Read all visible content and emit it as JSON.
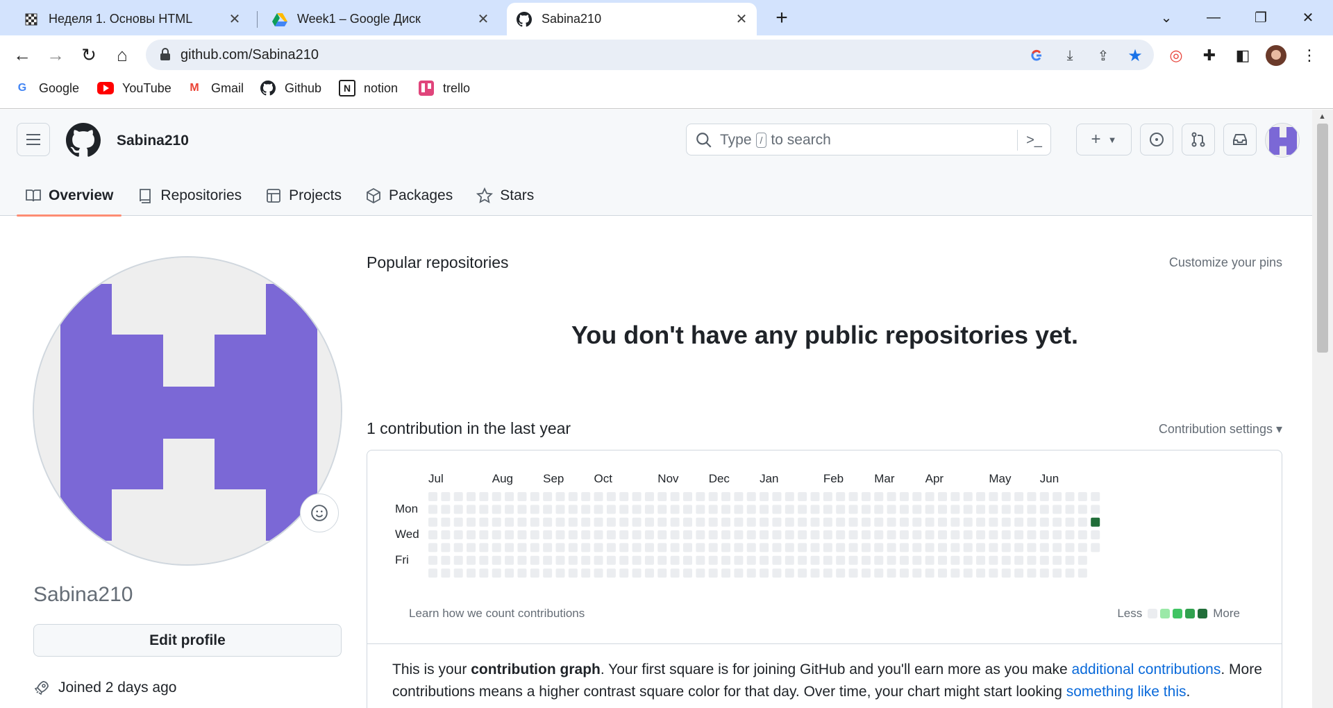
{
  "browser": {
    "tabs": [
      {
        "title": "Неделя 1. Основы HTML",
        "icon": "checkered-flag-icon"
      },
      {
        "title": "Week1 – Google Диск",
        "icon": "google-drive-icon"
      },
      {
        "title": "Sabina210",
        "icon": "github-icon"
      }
    ],
    "url": "github.com/Sabina210",
    "bookmarks": [
      "Google",
      "YouTube",
      "Gmail",
      "Github",
      "notion",
      "trello"
    ]
  },
  "github": {
    "username": "Sabina210",
    "search_placeholder_before": "Type",
    "search_key": "/",
    "search_placeholder_after": "to search",
    "tabs": [
      "Overview",
      "Repositories",
      "Projects",
      "Packages",
      "Stars"
    ],
    "profile_name": "Sabina210",
    "edit_profile": "Edit profile",
    "joined": "Joined 2 days ago",
    "popular_title": "Popular repositories",
    "customize": "Customize your pins",
    "no_repos": "You don't have any public repositories yet.",
    "contrib_title": "1 contribution in the last year",
    "contrib_settings": "Contribution settings ▾",
    "learn_link": "Learn how we count contributions",
    "legend_less": "Less",
    "legend_more": "More",
    "explain_1": "This is your ",
    "explain_bold": "contribution graph",
    "explain_2": ". Your first square is for joining GitHub and you'll earn more as you make ",
    "explain_link1": "additional contributions",
    "explain_3": ". More contributions means a higher contrast square color for that day. Over time, your chart might start looking ",
    "explain_link2": "something like this",
    "explain_4": "."
  },
  "chart_data": {
    "type": "heatmap",
    "months": [
      "Jul",
      "Aug",
      "Sep",
      "Oct",
      "Nov",
      "Dec",
      "Jan",
      "Feb",
      "Mar",
      "Apr",
      "May",
      "Jun"
    ],
    "day_labels": [
      "Mon",
      "Wed",
      "Fri"
    ],
    "weeks": 53,
    "contributions": [
      {
        "week": 52,
        "day": 2,
        "count": 1
      }
    ],
    "colors": {
      "empty": "#ebedf0",
      "l1": "#9be9a8",
      "l2": "#40c463",
      "l3": "#30a14e",
      "l4": "#216e39"
    }
  }
}
